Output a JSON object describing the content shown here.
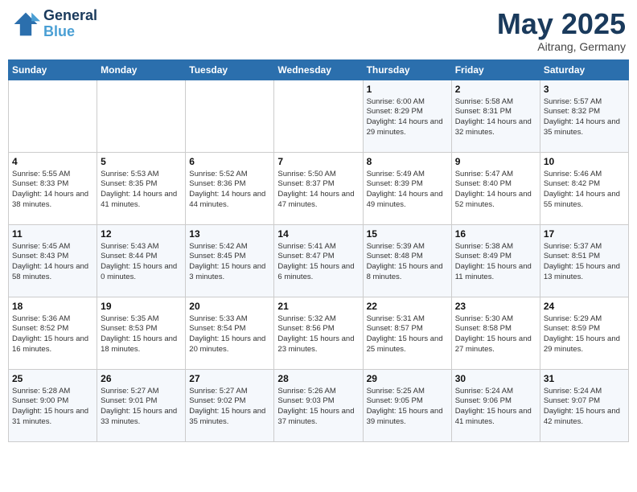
{
  "header": {
    "logo_line1": "General",
    "logo_line2": "Blue",
    "title": "May 2025",
    "location": "Aitrang, Germany"
  },
  "weekdays": [
    "Sunday",
    "Monday",
    "Tuesday",
    "Wednesday",
    "Thursday",
    "Friday",
    "Saturday"
  ],
  "weeks": [
    [
      {
        "day": "",
        "sunrise": "",
        "sunset": "",
        "daylight": ""
      },
      {
        "day": "",
        "sunrise": "",
        "sunset": "",
        "daylight": ""
      },
      {
        "day": "",
        "sunrise": "",
        "sunset": "",
        "daylight": ""
      },
      {
        "day": "",
        "sunrise": "",
        "sunset": "",
        "daylight": ""
      },
      {
        "day": "1",
        "sunrise": "Sunrise: 6:00 AM",
        "sunset": "Sunset: 8:29 PM",
        "daylight": "Daylight: 14 hours and 29 minutes."
      },
      {
        "day": "2",
        "sunrise": "Sunrise: 5:58 AM",
        "sunset": "Sunset: 8:31 PM",
        "daylight": "Daylight: 14 hours and 32 minutes."
      },
      {
        "day": "3",
        "sunrise": "Sunrise: 5:57 AM",
        "sunset": "Sunset: 8:32 PM",
        "daylight": "Daylight: 14 hours and 35 minutes."
      }
    ],
    [
      {
        "day": "4",
        "sunrise": "Sunrise: 5:55 AM",
        "sunset": "Sunset: 8:33 PM",
        "daylight": "Daylight: 14 hours and 38 minutes."
      },
      {
        "day": "5",
        "sunrise": "Sunrise: 5:53 AM",
        "sunset": "Sunset: 8:35 PM",
        "daylight": "Daylight: 14 hours and 41 minutes."
      },
      {
        "day": "6",
        "sunrise": "Sunrise: 5:52 AM",
        "sunset": "Sunset: 8:36 PM",
        "daylight": "Daylight: 14 hours and 44 minutes."
      },
      {
        "day": "7",
        "sunrise": "Sunrise: 5:50 AM",
        "sunset": "Sunset: 8:37 PM",
        "daylight": "Daylight: 14 hours and 47 minutes."
      },
      {
        "day": "8",
        "sunrise": "Sunrise: 5:49 AM",
        "sunset": "Sunset: 8:39 PM",
        "daylight": "Daylight: 14 hours and 49 minutes."
      },
      {
        "day": "9",
        "sunrise": "Sunrise: 5:47 AM",
        "sunset": "Sunset: 8:40 PM",
        "daylight": "Daylight: 14 hours and 52 minutes."
      },
      {
        "day": "10",
        "sunrise": "Sunrise: 5:46 AM",
        "sunset": "Sunset: 8:42 PM",
        "daylight": "Daylight: 14 hours and 55 minutes."
      }
    ],
    [
      {
        "day": "11",
        "sunrise": "Sunrise: 5:45 AM",
        "sunset": "Sunset: 8:43 PM",
        "daylight": "Daylight: 14 hours and 58 minutes."
      },
      {
        "day": "12",
        "sunrise": "Sunrise: 5:43 AM",
        "sunset": "Sunset: 8:44 PM",
        "daylight": "Daylight: 15 hours and 0 minutes."
      },
      {
        "day": "13",
        "sunrise": "Sunrise: 5:42 AM",
        "sunset": "Sunset: 8:45 PM",
        "daylight": "Daylight: 15 hours and 3 minutes."
      },
      {
        "day": "14",
        "sunrise": "Sunrise: 5:41 AM",
        "sunset": "Sunset: 8:47 PM",
        "daylight": "Daylight: 15 hours and 6 minutes."
      },
      {
        "day": "15",
        "sunrise": "Sunrise: 5:39 AM",
        "sunset": "Sunset: 8:48 PM",
        "daylight": "Daylight: 15 hours and 8 minutes."
      },
      {
        "day": "16",
        "sunrise": "Sunrise: 5:38 AM",
        "sunset": "Sunset: 8:49 PM",
        "daylight": "Daylight: 15 hours and 11 minutes."
      },
      {
        "day": "17",
        "sunrise": "Sunrise: 5:37 AM",
        "sunset": "Sunset: 8:51 PM",
        "daylight": "Daylight: 15 hours and 13 minutes."
      }
    ],
    [
      {
        "day": "18",
        "sunrise": "Sunrise: 5:36 AM",
        "sunset": "Sunset: 8:52 PM",
        "daylight": "Daylight: 15 hours and 16 minutes."
      },
      {
        "day": "19",
        "sunrise": "Sunrise: 5:35 AM",
        "sunset": "Sunset: 8:53 PM",
        "daylight": "Daylight: 15 hours and 18 minutes."
      },
      {
        "day": "20",
        "sunrise": "Sunrise: 5:33 AM",
        "sunset": "Sunset: 8:54 PM",
        "daylight": "Daylight: 15 hours and 20 minutes."
      },
      {
        "day": "21",
        "sunrise": "Sunrise: 5:32 AM",
        "sunset": "Sunset: 8:56 PM",
        "daylight": "Daylight: 15 hours and 23 minutes."
      },
      {
        "day": "22",
        "sunrise": "Sunrise: 5:31 AM",
        "sunset": "Sunset: 8:57 PM",
        "daylight": "Daylight: 15 hours and 25 minutes."
      },
      {
        "day": "23",
        "sunrise": "Sunrise: 5:30 AM",
        "sunset": "Sunset: 8:58 PM",
        "daylight": "Daylight: 15 hours and 27 minutes."
      },
      {
        "day": "24",
        "sunrise": "Sunrise: 5:29 AM",
        "sunset": "Sunset: 8:59 PM",
        "daylight": "Daylight: 15 hours and 29 minutes."
      }
    ],
    [
      {
        "day": "25",
        "sunrise": "Sunrise: 5:28 AM",
        "sunset": "Sunset: 9:00 PM",
        "daylight": "Daylight: 15 hours and 31 minutes."
      },
      {
        "day": "26",
        "sunrise": "Sunrise: 5:27 AM",
        "sunset": "Sunset: 9:01 PM",
        "daylight": "Daylight: 15 hours and 33 minutes."
      },
      {
        "day": "27",
        "sunrise": "Sunrise: 5:27 AM",
        "sunset": "Sunset: 9:02 PM",
        "daylight": "Daylight: 15 hours and 35 minutes."
      },
      {
        "day": "28",
        "sunrise": "Sunrise: 5:26 AM",
        "sunset": "Sunset: 9:03 PM",
        "daylight": "Daylight: 15 hours and 37 minutes."
      },
      {
        "day": "29",
        "sunrise": "Sunrise: 5:25 AM",
        "sunset": "Sunset: 9:05 PM",
        "daylight": "Daylight: 15 hours and 39 minutes."
      },
      {
        "day": "30",
        "sunrise": "Sunrise: 5:24 AM",
        "sunset": "Sunset: 9:06 PM",
        "daylight": "Daylight: 15 hours and 41 minutes."
      },
      {
        "day": "31",
        "sunrise": "Sunrise: 5:24 AM",
        "sunset": "Sunset: 9:07 PM",
        "daylight": "Daylight: 15 hours and 42 minutes."
      }
    ]
  ]
}
